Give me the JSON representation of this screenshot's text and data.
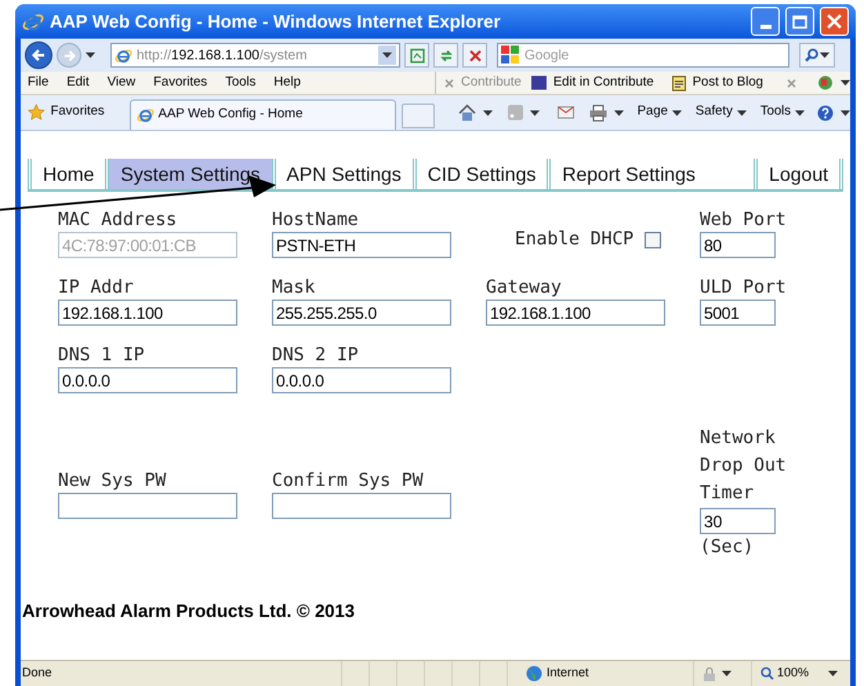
{
  "window": {
    "title": "AAP Web Config - Home - Windows Internet Explorer"
  },
  "address_bar": {
    "url_parts": [
      {
        "text": "http://",
        "dim": true
      },
      {
        "text": "192.168.1.100",
        "dim": false
      },
      {
        "text": "/system",
        "dim": true
      }
    ]
  },
  "search": {
    "placeholder": "Google"
  },
  "menu": [
    "File",
    "Edit",
    "View",
    "Favorites",
    "Tools",
    "Help"
  ],
  "contribute_bar": {
    "contribute": "Contribute",
    "edit": "Edit in Contribute",
    "blog": "Post to Blog"
  },
  "favorites_bar": {
    "favorites": "Favorites",
    "tab": "AAP Web Config - Home",
    "commands": [
      "Page",
      "Safety",
      "Tools"
    ]
  },
  "page_tabs": [
    {
      "label": "Home",
      "selected": false
    },
    {
      "label": "System Settings",
      "selected": true
    },
    {
      "label": "APN Settings",
      "selected": false
    },
    {
      "label": "CID Settings",
      "selected": false
    },
    {
      "label": "Report Settings",
      "selected": false
    },
    {
      "label": "Logout",
      "selected": false
    }
  ],
  "form_rows": [
    [
      {
        "kind": "text",
        "label": "MAC Address",
        "value": "4C:78:97:00:01:CB",
        "disabled": true
      },
      {
        "kind": "text",
        "label": "HostName",
        "value": "PSTN-ETH",
        "disabled": false
      },
      {
        "kind": "checkbox",
        "label": "Enable DHCP",
        "checked": false
      },
      {
        "kind": "text",
        "label": "Web Port",
        "value": "80",
        "disabled": false
      }
    ],
    [
      {
        "kind": "text",
        "label": "IP Addr",
        "value": "192.168.1.100",
        "disabled": false
      },
      {
        "kind": "text",
        "label": "Mask",
        "value": "255.255.255.0",
        "disabled": false
      },
      {
        "kind": "text",
        "label": "Gateway",
        "value": "192.168.1.100",
        "disabled": false
      },
      {
        "kind": "text",
        "label": "ULD Port",
        "value": "5001",
        "disabled": false
      }
    ],
    [
      {
        "kind": "text",
        "label": "DNS 1 IP",
        "value": "0.0.0.0",
        "disabled": false
      },
      {
        "kind": "text",
        "label": "DNS 2 IP",
        "value": "0.0.0.0",
        "disabled": false
      }
    ],
    [
      {
        "kind": "text",
        "label": "New Sys PW",
        "disabled": false
      },
      {
        "kind": "text",
        "label": "Confirm Sys PW",
        "disabled": false
      },
      {
        "kind": "timer",
        "label": "Network Drop Out Timer",
        "value": "30",
        "unit": "(Sec)"
      }
    ]
  ],
  "footer": "Arrowhead Alarm Products Ltd. © 2013",
  "status_bar": {
    "status": "Done",
    "zone": "Internet",
    "zoom": "100%"
  }
}
